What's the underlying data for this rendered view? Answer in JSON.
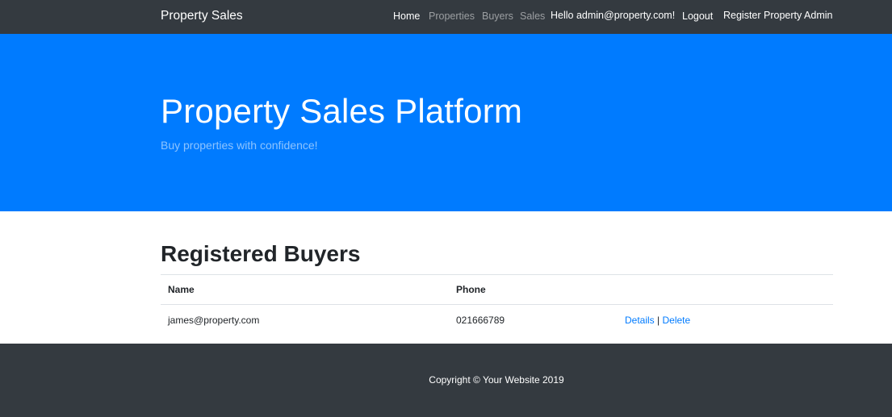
{
  "navbar": {
    "brand": "Property Sales",
    "links": [
      {
        "label": "Home"
      },
      {
        "label": "Properties"
      },
      {
        "label": "Buyers"
      },
      {
        "label": "Sales"
      }
    ],
    "greeting": "Hello admin@property.com!",
    "logout": "Logout",
    "register": "Register Property Admin"
  },
  "hero": {
    "title": "Property Sales Platform",
    "subtitle": "Buy properties with confidence!"
  },
  "main": {
    "title": "Registered Buyers",
    "table": {
      "headers": [
        "Name",
        "Phone",
        ""
      ],
      "rows": [
        {
          "name": "james@property.com",
          "phone": "021666789",
          "details": "Details",
          "separator": "|",
          "delete": "Delete"
        }
      ]
    }
  },
  "footer": {
    "copyright": "Copyright © Your Website 2019"
  },
  "colors": {
    "navbar_bg": "#343a40",
    "hero_bg": "#007bff",
    "link": "#007bff"
  }
}
